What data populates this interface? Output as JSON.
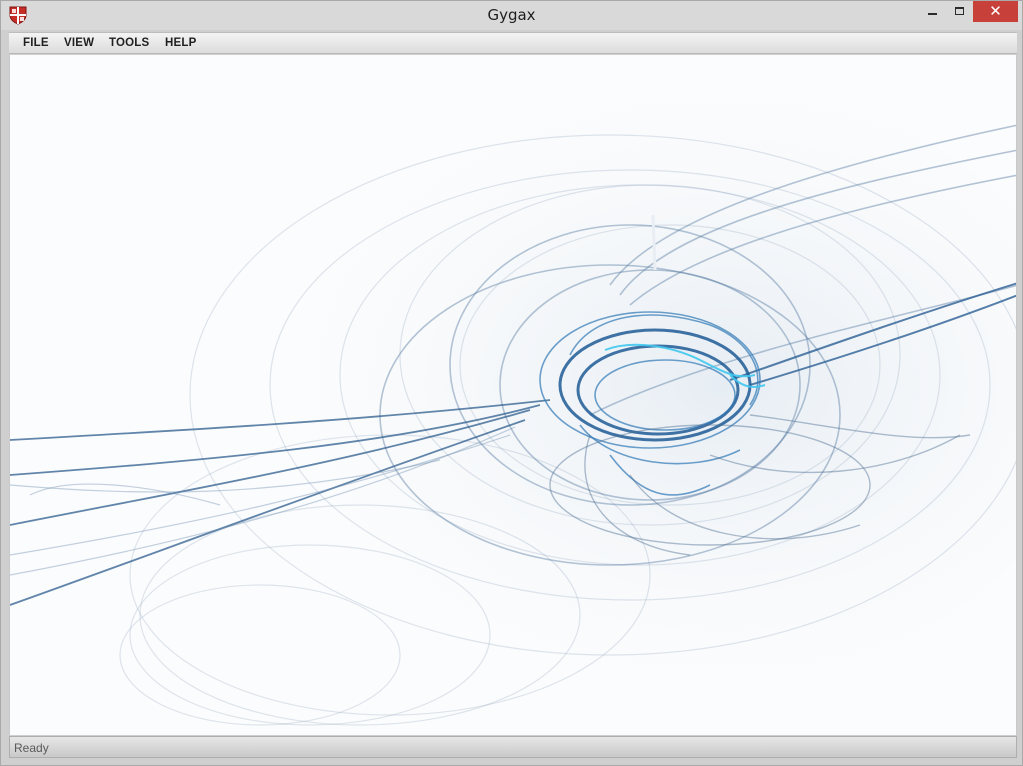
{
  "window": {
    "title": "Gygax",
    "close_glyph": "✕"
  },
  "menu": {
    "items": [
      {
        "label": "FILE"
      },
      {
        "label": "VIEW"
      },
      {
        "label": "TOOLS"
      },
      {
        "label": "HELP"
      }
    ]
  },
  "icons": {
    "app": "shield-icon",
    "minimize": "minimize-icon",
    "maximize": "maximize-icon",
    "close": "close-icon"
  },
  "colors": {
    "close_button": "#c7413a",
    "fractal_dark": "#1f5a95",
    "fractal_glow": "#3fc8ee",
    "canvas_bg": "#fbfcfd"
  },
  "status": {
    "text": "Ready"
  }
}
